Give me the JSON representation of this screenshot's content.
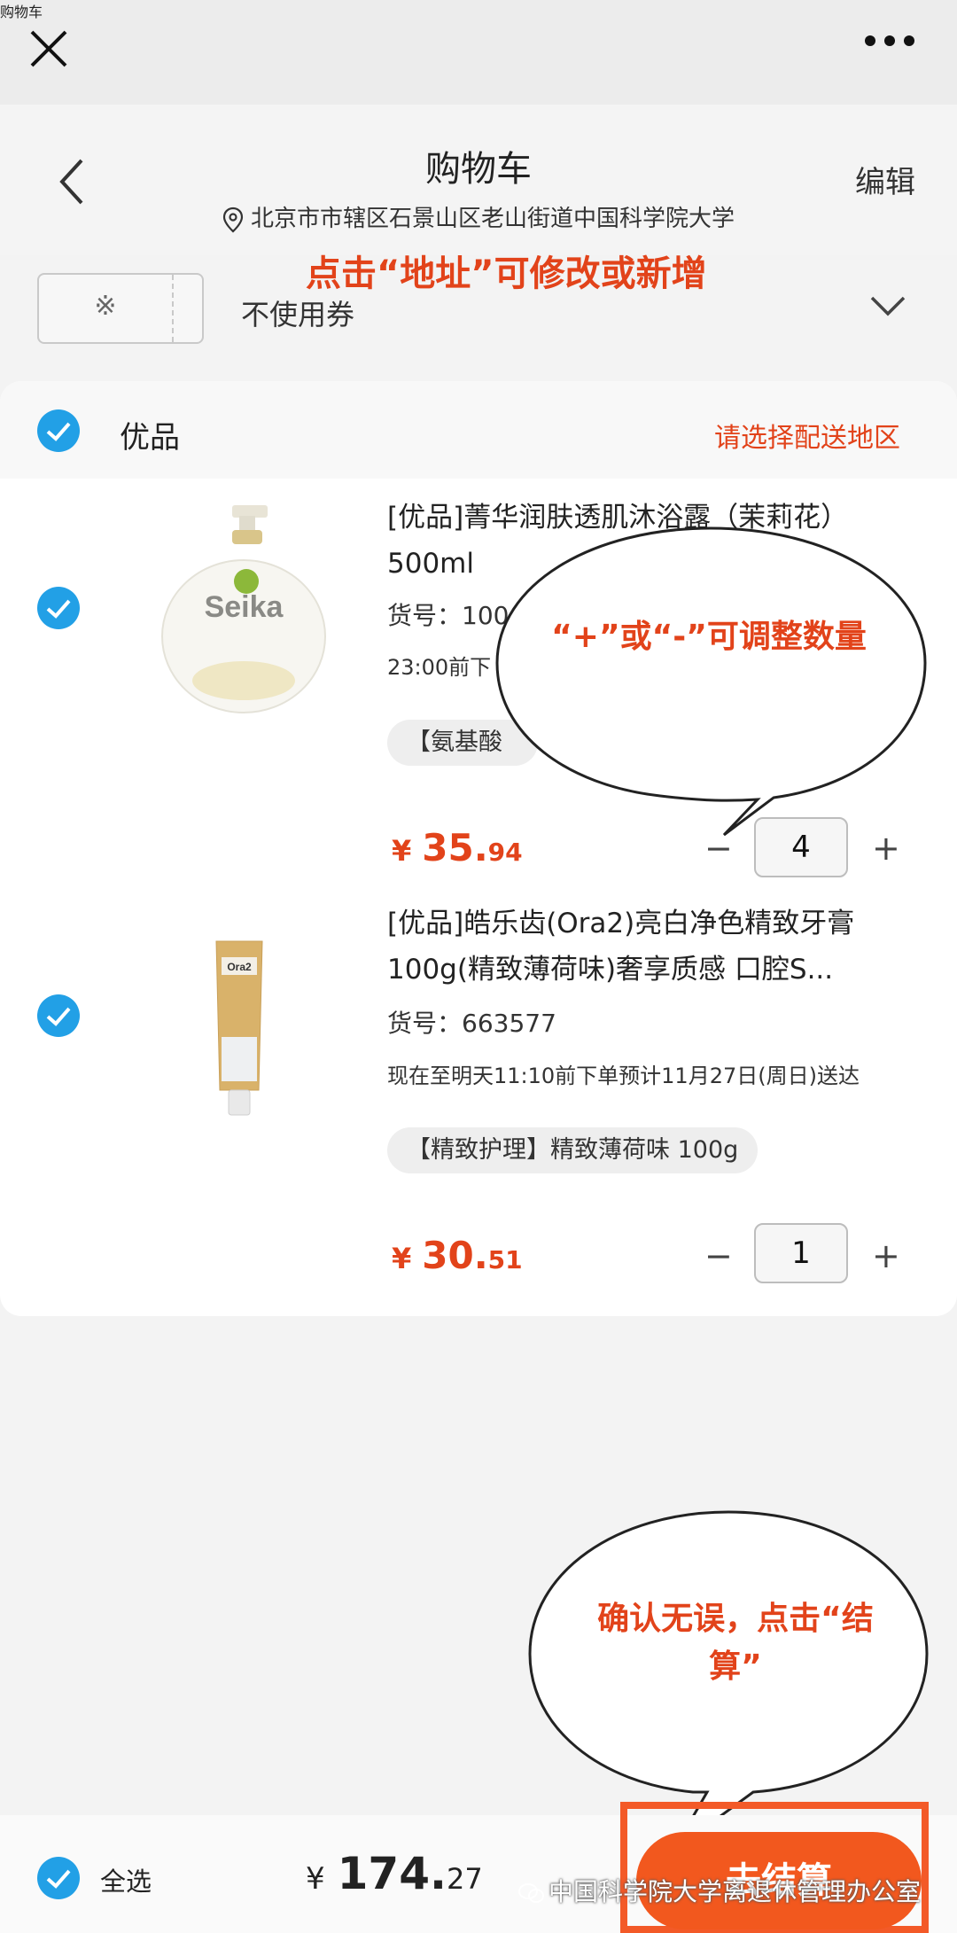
{
  "window": {
    "title": "购物车"
  },
  "header": {
    "title": "购物车",
    "edit_label": "编辑",
    "address": "北京市市辖区石景山区老山街道中国科学院大学"
  },
  "annotations": {
    "address_hint": "点击“地址”可修改或新增",
    "quantity_hint": "“+”或“-”可调整数量",
    "checkout_hint": "确认无误，点击“结算”"
  },
  "coupon": {
    "symbol": "※",
    "label": "不使用券"
  },
  "shop": {
    "name": "优品",
    "region_prompt": "请选择配送地区",
    "selected": true
  },
  "items": [
    {
      "selected": true,
      "title": "[优品]菁华润肤透肌沐浴露（茉莉花）500ml",
      "sku": "货号：100",
      "delivery": "23:00前下",
      "tag": "【氨基酸",
      "price_currency": "¥",
      "price_int": "35.",
      "price_dec": "94",
      "quantity": "4",
      "image_brand": "Seika"
    },
    {
      "selected": true,
      "title": "[优品]皓乐齿(Ora2)亮白净色精致牙膏100g(精致薄荷味)奢享质感 口腔S...",
      "sku": "货号：663577",
      "delivery": "现在至明天11:10前下单预计11月27日(周日)送达",
      "tag": "【精致护理】精致薄荷味 100g",
      "price_currency": "¥",
      "price_int": "30.",
      "price_dec": "51",
      "quantity": "1",
      "image_brand": "Ora2"
    }
  ],
  "qty_controls": {
    "minus": "−",
    "plus": "+"
  },
  "footer": {
    "select_all_label": "全选",
    "total_currency": "¥",
    "total_int": "174.",
    "total_dec": "27",
    "checkout_label": "去结算",
    "watermark": "中国科学院大学离退休管理办公室"
  },
  "colors": {
    "accent": "#e2431a",
    "check": "#22a0e6",
    "button": "#f2581e"
  }
}
